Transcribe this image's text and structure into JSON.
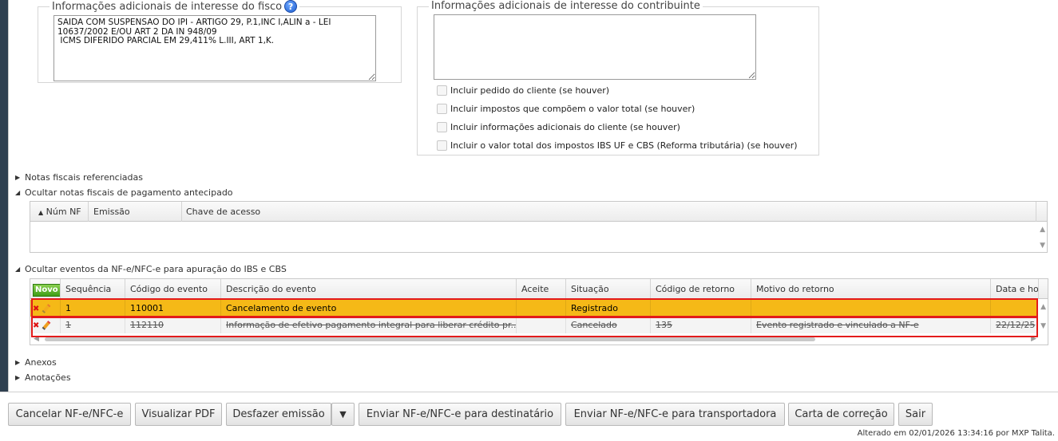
{
  "fisco": {
    "legend": "Informações adicionais de interesse do fisco",
    "text": "SAIDA COM SUSPENSAO DO IPI - ARTIGO 29, P.1,INC I,ALIN a - LEI 10637/2002 E/OU ART 2 DA IN 948/09\n ICMS DIFERIDO PARCIAL EM 29,411% L.III, ART 1,K."
  },
  "contribuinte": {
    "legend": "Informações adicionais de interesse do contribuinte",
    "text": "",
    "checkboxes": [
      "Incluir pedido do cliente (se houver)",
      "Incluir impostos que compõem o valor total (se houver)",
      "Incluir informações adicionais do cliente (se houver)",
      "Incluir o valor total dos impostos IBS UF e CBS (Reforma tributária) (se houver)"
    ]
  },
  "sections": {
    "referenciadas": "Notas fiscais referenciadas",
    "antecipado": "Ocultar notas fiscais de pagamento antecipado",
    "eventos": "Ocultar eventos da NF-e/NFC-e para apuração do IBS e CBS",
    "anexos": "Anexos",
    "anotacoes": "Anotações"
  },
  "antecipado_grid": {
    "columns": [
      "Núm NF",
      "Emissão",
      "Chave de acesso"
    ]
  },
  "eventos_grid": {
    "novo_label": "Novo",
    "columns": [
      "Sequência",
      "Código do evento",
      "Descrição do evento",
      "Aceite",
      "Situação",
      "Código de retorno",
      "Motivo do retorno",
      "Data e ho"
    ],
    "rows": [
      [
        "1",
        "110001",
        "Cancelamento de evento",
        "",
        "Registrado",
        "",
        "",
        ""
      ],
      [
        "1",
        "112110",
        "Informação de efetivo pagamento integral para liberar crédito pr...",
        "",
        "Cancelado",
        "135",
        "Evento registrado e vinculado a NF-e",
        "22/12/25"
      ]
    ]
  },
  "buttons": {
    "cancelar": "Cancelar NF-e/NFC-e",
    "visualizar": "Visualizar PDF",
    "desfazer": "Desfazer emissão",
    "dropdown": "▼",
    "enviar_dest": "Enviar NF-e/NFC-e para destinatário",
    "enviar_transp": "Enviar NF-e/NFC-e para transportadora",
    "carta": "Carta de correção",
    "sair": "Sair"
  },
  "footer": "Alterado em 02/01/2026 13:34:16 por MXP Talita."
}
